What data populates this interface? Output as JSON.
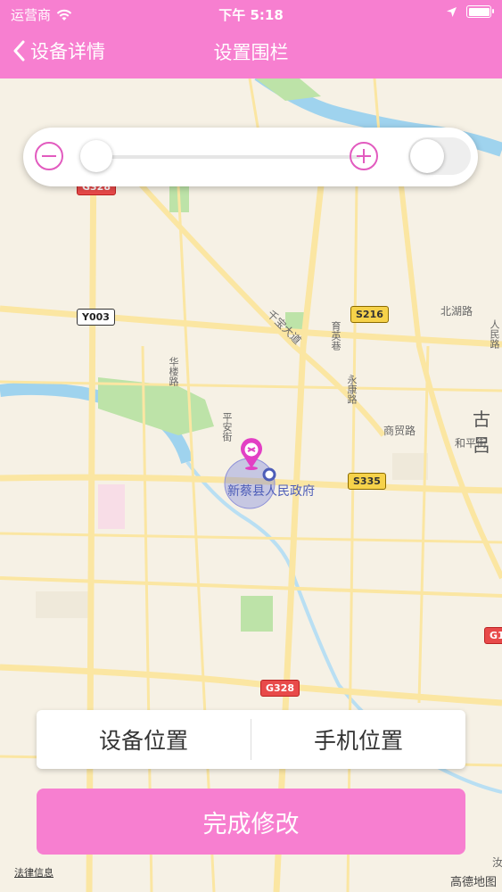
{
  "status_bar": {
    "carrier": "运营商",
    "time": "下午 5:18",
    "icons": [
      "wifi-icon",
      "location-arrow-icon",
      "battery-icon"
    ]
  },
  "nav": {
    "back_label": "设备详情",
    "title": "设置围栏"
  },
  "colors": {
    "brand": "#f77fd0",
    "accent": "#e25bbf",
    "road": "#fbe6a2",
    "water": "#9fd3ee",
    "green": "#bde3a8"
  },
  "zoom_control": {
    "slider_value": 0.0,
    "fence_toggle_on": false
  },
  "map": {
    "road_labels": [
      "千宝大道",
      "北湖路",
      "华楼路",
      "育英巷",
      "永康路",
      "商贸路",
      "平安街",
      "和平街",
      "人民路"
    ],
    "place_large": "古吕",
    "poi": "新蔡县人民政府",
    "shields": {
      "g328_top": "G328",
      "y003": "Y003",
      "s216": "S216",
      "s335": "S335",
      "g328_bottom": "G328",
      "g1_edge": "G1"
    },
    "bottom_label": "汝",
    "legal_link": "法律信息",
    "provider": "高德地图"
  },
  "actions": {
    "device_location": "设备位置",
    "phone_location": "手机位置",
    "done": "完成修改"
  }
}
